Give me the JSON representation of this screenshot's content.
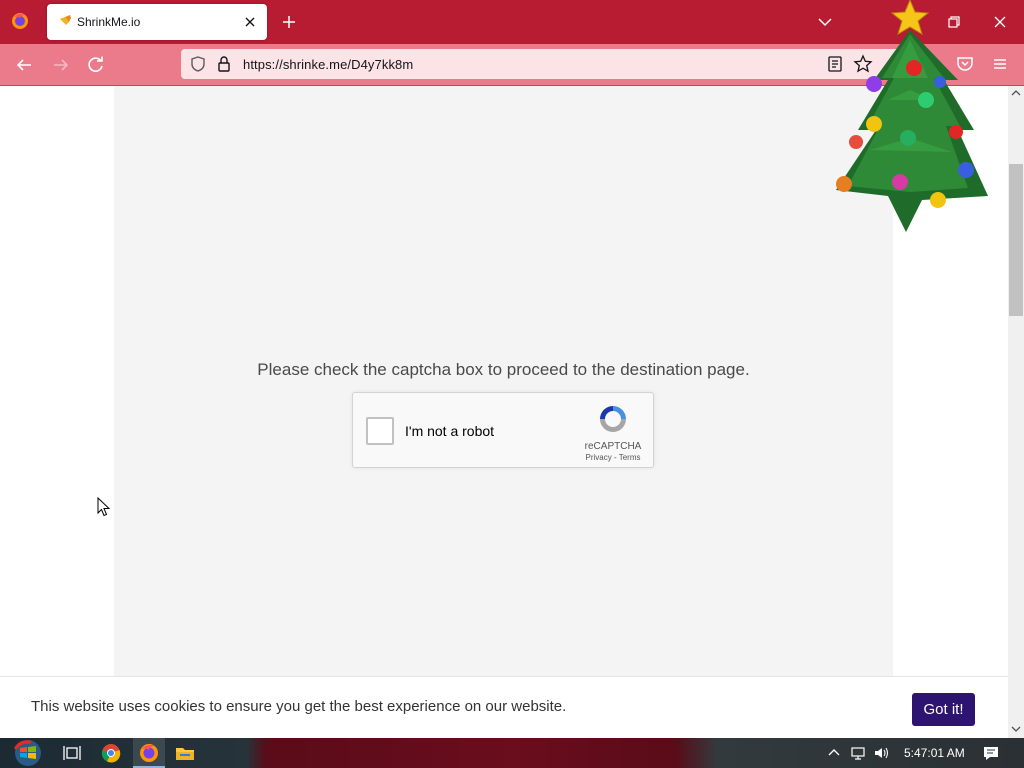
{
  "browser": {
    "tab": {
      "title": "ShrinkMe.io",
      "favicon": "hand-pointer-icon"
    },
    "url": "https://shrinke.me/D4y7kk8m",
    "colors": {
      "tabbar": "#b81c33",
      "navbar": "#eb7a8b",
      "urlbar": "#fbe3e6"
    }
  },
  "page": {
    "captcha_message": "Please check the captcha box to proceed to the destination page.",
    "recaptcha": {
      "label": "I'm not a robot",
      "brand": "reCAPTCHA",
      "privacy": "Privacy",
      "separator": " - ",
      "terms": "Terms"
    },
    "cookie_bar": {
      "text": "This website uses cookies to ensure you get the best experience on our website.",
      "button": "Got it!",
      "button_color": "#2d1470"
    }
  },
  "taskbar": {
    "clock": "5:47:01 AM",
    "pinned": [
      "start-icon",
      "task-view-icon",
      "chrome-icon",
      "firefox-icon",
      "file-explorer-icon"
    ]
  },
  "decoration": {
    "overlay": "christmas-tree"
  }
}
